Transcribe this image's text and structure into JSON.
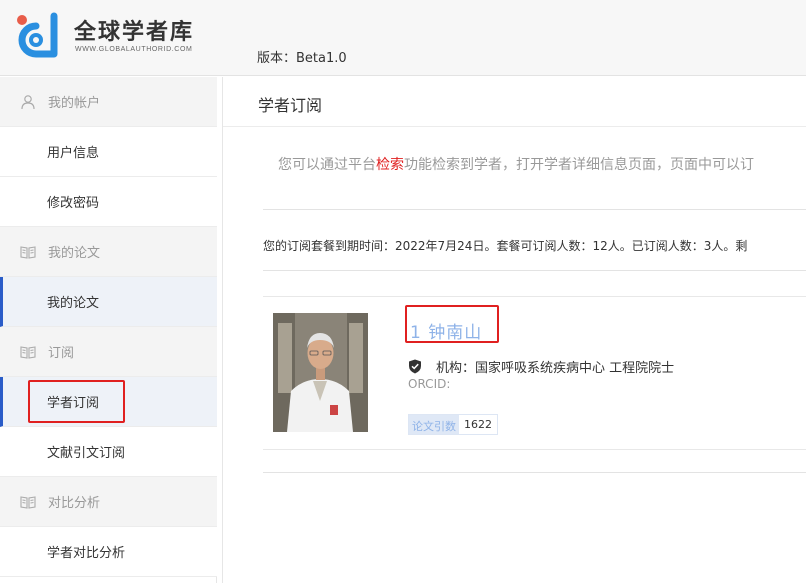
{
  "header": {
    "brand_title": "全球学者库",
    "brand_sub": "WWW.GLOBALAUTHORID.COM",
    "version": "版本：Beta1.0"
  },
  "sidebar": {
    "items": [
      {
        "type": "group",
        "label": "我的帐户",
        "icon": "user-icon"
      },
      {
        "type": "sub",
        "label": "用户信息"
      },
      {
        "type": "sub",
        "label": "修改密码"
      },
      {
        "type": "group",
        "label": "我的论文",
        "icon": "book-icon"
      },
      {
        "type": "sub",
        "label": "我的论文"
      },
      {
        "type": "group",
        "label": "订阅",
        "icon": "book-icon"
      },
      {
        "type": "sub",
        "label": "学者订阅",
        "active": true
      },
      {
        "type": "sub",
        "label": "文献引文订阅"
      },
      {
        "type": "group",
        "label": "对比分析",
        "icon": "book-icon"
      },
      {
        "type": "sub",
        "label": "学者对比分析"
      }
    ]
  },
  "main": {
    "title": "学者订阅",
    "tip_pre": "您可以通过平台",
    "tip_link": "检索",
    "tip_post": "功能检索到学者，打开学者详细信息页面，页面中可以订",
    "subscription_info": "您的订阅套餐到期时间：2022年7月24日。套餐可订阅人数：12人。已订阅人数：3人。剩",
    "scholar": {
      "name": "1 钟南山",
      "org": "机构：国家呼吸系统疾病中心 工程院院士",
      "orcid": "ORCID:",
      "badge_label": "论文引数",
      "badge_value": "1622"
    }
  },
  "colors": {
    "accent": "#2a5cc8",
    "highlight": "#e02020",
    "link_blue": "#8fb3e8"
  }
}
